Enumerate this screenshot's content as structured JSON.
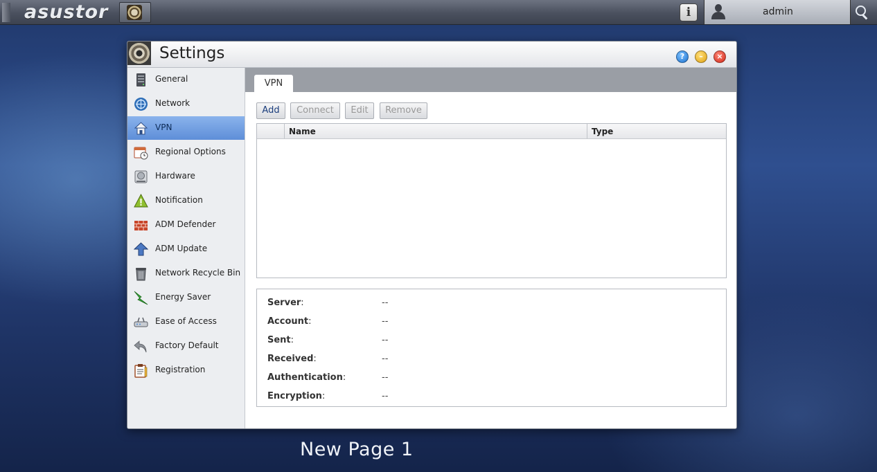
{
  "topbar": {
    "logo": "asustor",
    "user": "admin"
  },
  "window": {
    "title": "Settings"
  },
  "sidebar": {
    "items": [
      {
        "label": "General",
        "icon": "server-icon"
      },
      {
        "label": "Network",
        "icon": "globe-icon"
      },
      {
        "label": "VPN",
        "icon": "vpn-house-icon",
        "active": true
      },
      {
        "label": "Regional Options",
        "icon": "calendar-clock-icon"
      },
      {
        "label": "Hardware",
        "icon": "hard-drive-icon"
      },
      {
        "label": "Notification",
        "icon": "warning-icon"
      },
      {
        "label": "ADM Defender",
        "icon": "firewall-brick-icon"
      },
      {
        "label": "ADM Update",
        "icon": "up-arrow-icon"
      },
      {
        "label": "Network Recycle Bin",
        "icon": "trash-bin-icon"
      },
      {
        "label": "Energy Saver",
        "icon": "lightning-icon"
      },
      {
        "label": "Ease of Access",
        "icon": "router-icon"
      },
      {
        "label": "Factory Default",
        "icon": "undo-arrow-icon"
      },
      {
        "label": "Registration",
        "icon": "clipboard-icon"
      }
    ]
  },
  "content": {
    "tab": "VPN",
    "toolbar": {
      "add": "Add",
      "connect": "Connect",
      "edit": "Edit",
      "remove": "Remove"
    },
    "table": {
      "columns": [
        "Name",
        "Type"
      ],
      "rows": []
    },
    "details": [
      {
        "label": "Server",
        "value": "--"
      },
      {
        "label": "Account",
        "value": "--"
      },
      {
        "label": "Sent",
        "value": "--"
      },
      {
        "label": "Received",
        "value": "--"
      },
      {
        "label": "Authentication",
        "value": "--"
      },
      {
        "label": "Encryption",
        "value": "--"
      }
    ]
  },
  "desktop": {
    "caption": "New Page 1"
  }
}
